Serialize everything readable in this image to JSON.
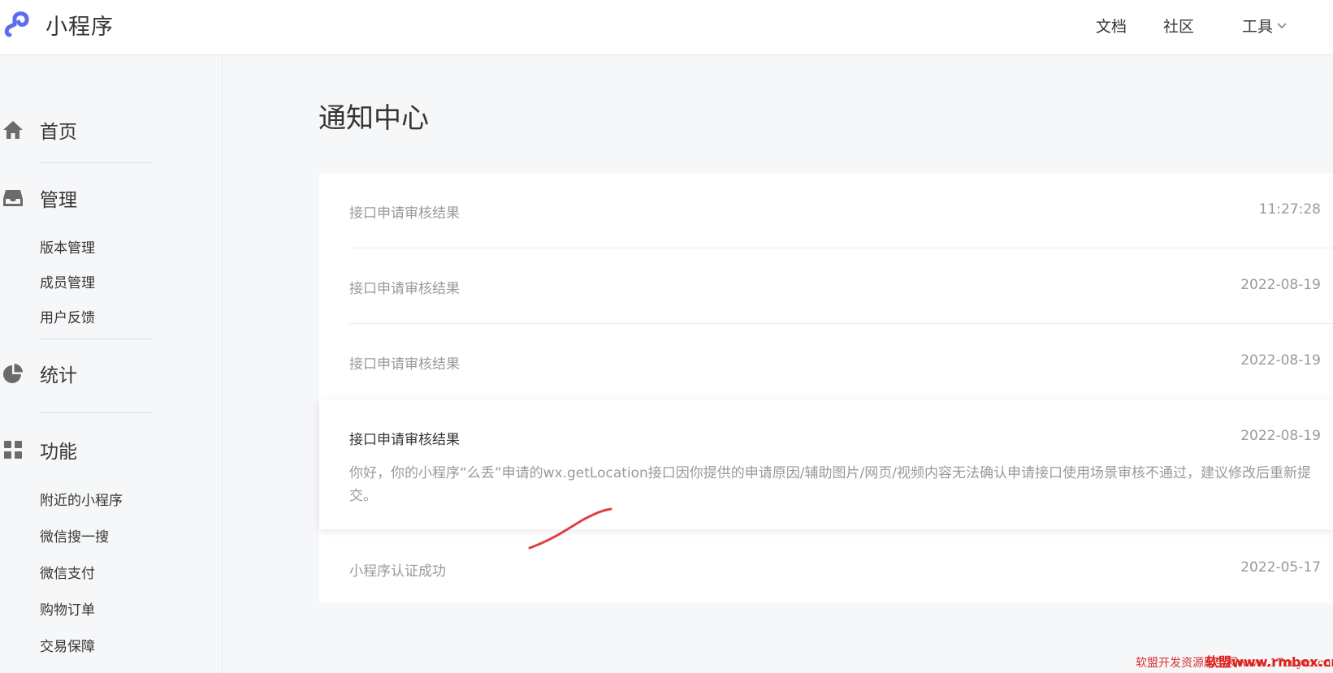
{
  "header": {
    "app_name": "小程序",
    "nav": {
      "docs": "文档",
      "community": "社区",
      "tools": "工具"
    }
  },
  "sidebar": {
    "home": "首页",
    "manage": {
      "label": "管理",
      "items": [
        "版本管理",
        "成员管理",
        "用户反馈"
      ]
    },
    "stats": "统计",
    "features": {
      "label": "功能",
      "items": [
        "附近的小程序",
        "微信搜一搜",
        "微信支付",
        "购物订单",
        "交易保障"
      ]
    }
  },
  "main": {
    "title": "通知中心",
    "notifications": [
      {
        "title": "接口申请审核结果",
        "time": "11:27:28"
      },
      {
        "title": "接口申请审核结果",
        "time": "2022-08-19"
      },
      {
        "title": "接口申请审核结果",
        "time": "2022-08-19"
      },
      {
        "title": "接口申请审核结果",
        "time": "2022-08-19",
        "body": "你好，你的小程序“么丢”申请的wx.getLocation接口因你提供的申请原因/辅助图片/网页/视频内容无法确认申请接口使用场景审核不通过，建议修改后重新提交。"
      },
      {
        "title": "小程序认证成功",
        "time": "2022-05-17"
      }
    ]
  },
  "watermark": {
    "text": "软盟开发资源服务网www.17ruym.cn",
    "overlay": "软盟www.rmbox.cn"
  },
  "colors": {
    "brand": "#5b6cf0",
    "annotation": "#e04040"
  }
}
